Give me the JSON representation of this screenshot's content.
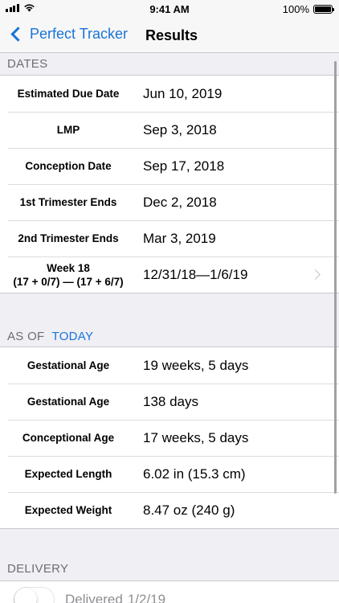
{
  "status_bar": {
    "time": "9:41 AM",
    "battery": "100%"
  },
  "nav": {
    "back_label": "Perfect Tracker",
    "title": "Results"
  },
  "dates": {
    "header": "DATES",
    "rows": [
      {
        "label": "Estimated Due Date",
        "value": "Jun 10, 2019"
      },
      {
        "label": "LMP",
        "value": "Sep 3, 2018"
      },
      {
        "label": "Conception Date",
        "value": "Sep 17, 2018"
      },
      {
        "label": "1st Trimester Ends",
        "value": "Dec 2, 2018"
      },
      {
        "label": "2nd Trimester Ends",
        "value": "Mar 3, 2019"
      },
      {
        "label_line1": "Week 18",
        "label_line2": "(17 + 0/7) — (17 + 6/7)",
        "value": "12/31/18—1/6/19"
      }
    ]
  },
  "as_of": {
    "header": "AS OF",
    "header_accent": "TODAY",
    "rows": [
      {
        "label": "Gestational Age",
        "value": "19 weeks, 5 days"
      },
      {
        "label": "Gestational Age",
        "value": "138 days"
      },
      {
        "label": "Conceptional Age",
        "value": "17 weeks, 5 days"
      },
      {
        "label": "Expected Length",
        "value": "6.02 in (15.3 cm)"
      },
      {
        "label": "Expected Weight",
        "value": "8.47 oz (240 g)"
      }
    ]
  },
  "delivery": {
    "header": "DELIVERY",
    "toggle_label": "Delivered",
    "toggle_date": "1/2/19",
    "toggle_on": false
  },
  "colors": {
    "accent": "#1a74d6",
    "background": "#efeff4",
    "secondary_text": "#6d6d72"
  }
}
